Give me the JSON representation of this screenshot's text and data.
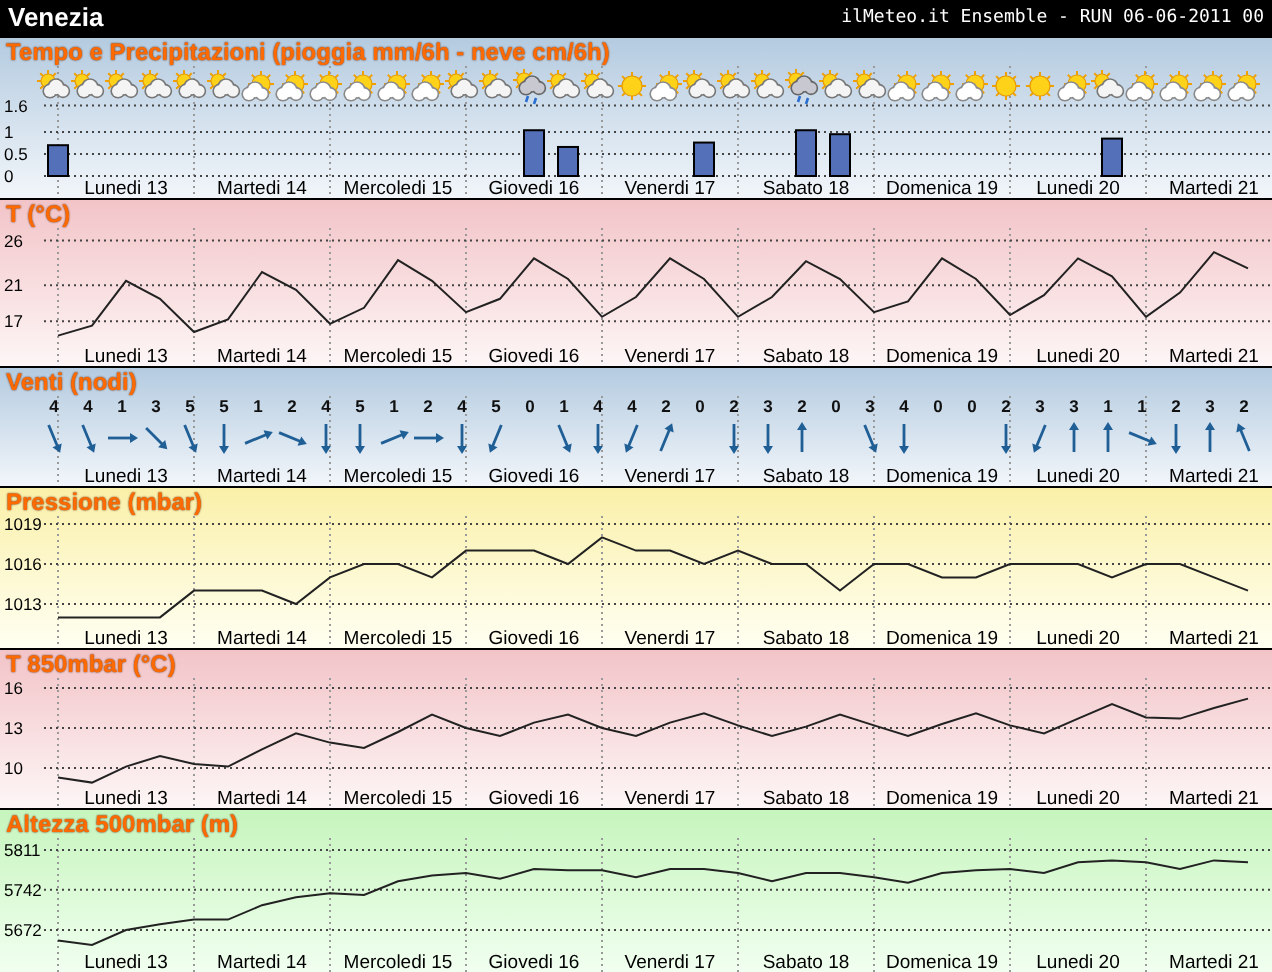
{
  "header": {
    "title": "Venezia",
    "run_info": "ilMeteo.it Ensemble - RUN 06-06-2011 00"
  },
  "panels": [
    {
      "kind": "precipitation",
      "title": "Tempo e Precipitazioni (pioggia mm/6h - neve cm/6h)",
      "weather_icons": [
        {
          "kind": "partly_cloudy"
        },
        {
          "kind": "partly_cloudy"
        },
        {
          "kind": "partly_cloudy"
        },
        {
          "kind": "partly_cloudy"
        },
        {
          "kind": "partly_cloudy"
        },
        {
          "kind": "partly_cloudy"
        },
        {
          "kind": "mostly_sunny"
        },
        {
          "kind": "mostly_sunny"
        },
        {
          "kind": "mostly_sunny"
        },
        {
          "kind": "mostly_sunny"
        },
        {
          "kind": "mostly_sunny"
        },
        {
          "kind": "mostly_sunny"
        },
        {
          "kind": "partly_cloudy"
        },
        {
          "kind": "partly_cloudy"
        },
        {
          "kind": "rain"
        },
        {
          "kind": "partly_cloudy"
        },
        {
          "kind": "partly_cloudy"
        },
        {
          "kind": "sun"
        },
        {
          "kind": "mostly_sunny"
        },
        {
          "kind": "partly_cloudy"
        },
        {
          "kind": "partly_cloudy"
        },
        {
          "kind": "partly_cloudy"
        },
        {
          "kind": "rain"
        },
        {
          "kind": "partly_cloudy"
        },
        {
          "kind": "partly_cloudy"
        },
        {
          "kind": "mostly_sunny"
        },
        {
          "kind": "mostly_sunny"
        },
        {
          "kind": "mostly_sunny"
        },
        {
          "kind": "sun"
        },
        {
          "kind": "sun"
        },
        {
          "kind": "mostly_sunny"
        },
        {
          "kind": "partly_cloudy"
        },
        {
          "kind": "mostly_sunny"
        },
        {
          "kind": "mostly_sunny"
        },
        {
          "kind": "mostly_sunny"
        },
        {
          "kind": "mostly_sunny"
        }
      ],
      "chart_data": {
        "type": "bar",
        "values": [
          0.7,
          0,
          0,
          0,
          0,
          0,
          0,
          0,
          0,
          0,
          0,
          0,
          0,
          0,
          1.04,
          0.66,
          0,
          0,
          0,
          0.76,
          0,
          0,
          1.04,
          0.95,
          0,
          0,
          0,
          0,
          0,
          0,
          0,
          0.85,
          0,
          0,
          0,
          0
        ],
        "ylim": [
          0,
          2.5
        ],
        "yticks": [
          0,
          0.5,
          1,
          1.6
        ],
        "grid": true
      },
      "day_labels": [
        "Lunedi 13",
        "Martedi 14",
        "Mercoledi 15",
        "Giovedi 16",
        "Venerdi 17",
        "Sabato 18",
        "Domenica 19",
        "Lunedi 20",
        "Martedi 21"
      ]
    },
    {
      "kind": "line",
      "title": "T (°C)",
      "chart_data": {
        "type": "line",
        "values": [
          15.4,
          16.5,
          21.5,
          19.5,
          15.8,
          17.2,
          22.5,
          20.5,
          16.7,
          18.5,
          23.8,
          21.5,
          18,
          19.5,
          24,
          21.7,
          17.5,
          19.7,
          24,
          21.7,
          17.5,
          19.7,
          23.7,
          21.7,
          18,
          19.2,
          24,
          21.7,
          17.7,
          19.9,
          24,
          22,
          17.5,
          20.2,
          24.7,
          22.9
        ],
        "ylim": [
          12,
          27.4
        ],
        "yticks": [
          17,
          21,
          26
        ],
        "grid": true
      },
      "day_labels": [
        "Lunedi 13",
        "Martedi 14",
        "Mercoledi 15",
        "Giovedi 16",
        "Venerdi 17",
        "Sabato 18",
        "Domenica 19",
        "Lunedi 20",
        "Martedi 21"
      ]
    },
    {
      "kind": "wind",
      "title": "Venti (nodi)",
      "entries": [
        {
          "speed": "4",
          "kind": "sse"
        },
        {
          "speed": "4",
          "kind": "sse"
        },
        {
          "speed": "1",
          "kind": "e"
        },
        {
          "speed": "3",
          "kind": "se"
        },
        {
          "speed": "5",
          "kind": "sse"
        },
        {
          "speed": "5",
          "kind": "s"
        },
        {
          "speed": "1",
          "kind": "ene"
        },
        {
          "speed": "2",
          "kind": "ese"
        },
        {
          "speed": "4",
          "kind": "s"
        },
        {
          "speed": "5",
          "kind": "s"
        },
        {
          "speed": "1",
          "kind": "ene"
        },
        {
          "speed": "2",
          "kind": "e"
        },
        {
          "speed": "4",
          "kind": "s"
        },
        {
          "speed": "5",
          "kind": "ssw"
        },
        {
          "speed": "0",
          "kind": "calm"
        },
        {
          "speed": "1",
          "kind": "sse"
        },
        {
          "speed": "4",
          "kind": "s"
        },
        {
          "speed": "4",
          "kind": "ssw"
        },
        {
          "speed": "2",
          "kind": "nne"
        },
        {
          "speed": "0",
          "kind": "calm"
        },
        {
          "speed": "2",
          "kind": "s"
        },
        {
          "speed": "3",
          "kind": "s"
        },
        {
          "speed": "2",
          "kind": "n"
        },
        {
          "speed": "0",
          "kind": "calm"
        },
        {
          "speed": "3",
          "kind": "sse"
        },
        {
          "speed": "4",
          "kind": "s"
        },
        {
          "speed": "0",
          "kind": "calm"
        },
        {
          "speed": "0",
          "kind": "calm"
        },
        {
          "speed": "2",
          "kind": "s"
        },
        {
          "speed": "3",
          "kind": "ssw"
        },
        {
          "speed": "3",
          "kind": "n"
        },
        {
          "speed": "1",
          "kind": "n"
        },
        {
          "speed": "1",
          "kind": "ese"
        },
        {
          "speed": "2",
          "kind": "s"
        },
        {
          "speed": "3",
          "kind": "n"
        },
        {
          "speed": "2",
          "kind": "nnw"
        }
      ],
      "day_labels": [
        "Lunedi 13",
        "Martedi 14",
        "Mercoledi 15",
        "Giovedi 16",
        "Venerdi 17",
        "Sabato 18",
        "Domenica 19",
        "Lunedi 20",
        "Martedi 21"
      ]
    },
    {
      "kind": "line",
      "title": "Pressione (mbar)",
      "chart_data": {
        "type": "line",
        "values": [
          1012,
          1012,
          1012,
          1012,
          1014,
          1014,
          1014,
          1013,
          1015,
          1016,
          1016,
          1015,
          1017,
          1017,
          1017,
          1016,
          1018,
          1017,
          1017,
          1016,
          1017,
          1016,
          1016,
          1014,
          1016,
          1016,
          1015,
          1015,
          1016,
          1016,
          1016,
          1015,
          1016,
          1016,
          1015,
          1014
        ],
        "ylim": [
          1009.7,
          1019.6
        ],
        "yticks": [
          1013,
          1016,
          1019
        ],
        "grid": true
      },
      "day_labels": [
        "Lunedi 13",
        "Martedi 14",
        "Mercoledi 15",
        "Giovedi 16",
        "Venerdi 17",
        "Sabato 18",
        "Domenica 19",
        "Lunedi 20",
        "Martedi 21"
      ]
    },
    {
      "kind": "line",
      "title": "T 850mbar (°C)",
      "chart_data": {
        "type": "line",
        "values": [
          9.3,
          8.9,
          10.1,
          10.9,
          10.3,
          10.1,
          11.4,
          12.6,
          11.9,
          11.5,
          12.7,
          14,
          13,
          12.4,
          13.4,
          14,
          13,
          12.4,
          13.4,
          14.1,
          13.2,
          12.4,
          13.1,
          14,
          13.2,
          12.4,
          13.3,
          14.1,
          13.2,
          12.6,
          13.7,
          14.8,
          13.8,
          13.7,
          14.5,
          15.2
        ],
        "ylim": [
          7,
          16.75
        ],
        "yticks": [
          10,
          13,
          16
        ],
        "grid": true
      },
      "day_labels": [
        "Lunedi 13",
        "Martedi 14",
        "Mercoledi 15",
        "Giovedi 16",
        "Venerdi 17",
        "Sabato 18",
        "Domenica 19",
        "Lunedi 20",
        "Martedi 21"
      ]
    },
    {
      "kind": "line",
      "title": "Altezza 500mbar (m)",
      "chart_data": {
        "type": "line",
        "values": [
          5654,
          5646,
          5672,
          5682,
          5690,
          5690,
          5715,
          5729,
          5736,
          5733,
          5757,
          5767,
          5771,
          5761,
          5778,
          5776,
          5776,
          5764,
          5778,
          5778,
          5771,
          5757,
          5771,
          5771,
          5764,
          5754,
          5771,
          5776,
          5778,
          5771,
          5790,
          5793,
          5790,
          5778,
          5793,
          5790
        ],
        "ylim": [
          5599,
          5832
        ],
        "yticks": [
          5672,
          5742,
          5811
        ],
        "grid": true
      },
      "day_labels": [
        "Lunedi 13",
        "Martedi 14",
        "Mercoledi 15",
        "Giovedi 16",
        "Venerdi 17",
        "Sabato 18",
        "Domenica 19",
        "Lunedi 20",
        "Martedi 21"
      ]
    }
  ]
}
